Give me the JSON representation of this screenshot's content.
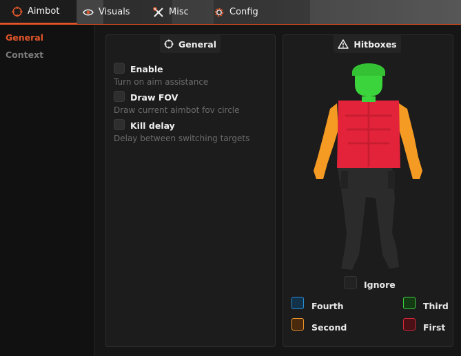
{
  "tabs": [
    {
      "label": "Aimbot",
      "icon": "crosshair-icon"
    },
    {
      "label": "Visuals",
      "icon": "eye-icon"
    },
    {
      "label": "Misc",
      "icon": "tools-icon"
    },
    {
      "label": "Config",
      "icon": "gear-icon"
    }
  ],
  "active_tab": "Aimbot",
  "sidebar": {
    "items": [
      {
        "label": "General",
        "active": true
      },
      {
        "label": "Context",
        "active": false
      }
    ]
  },
  "general_panel": {
    "title": "General",
    "title_icon": "crosshair-icon",
    "options": [
      {
        "label": "Enable",
        "description": "Turn on aim assistance",
        "checked": false
      },
      {
        "label": "Draw FOV",
        "description": "Draw current aimbot fov circle",
        "checked": false
      },
      {
        "label": "Kill delay",
        "description": "Delay between switching targets",
        "checked": false
      }
    ]
  },
  "hitbox_panel": {
    "title": "Hitboxes",
    "title_icon": "warning-triangle-icon",
    "ignore_label": "Ignore",
    "legend": [
      {
        "label": "Fourth",
        "color": "#2a8fd6"
      },
      {
        "label": "Third",
        "color": "#3fcf3f"
      },
      {
        "label": "Second",
        "color": "#f0952a"
      },
      {
        "label": "First",
        "color": "#d9283a"
      }
    ],
    "zones": {
      "head": "#3cd43c",
      "torso": "#e3233a",
      "arms": "#f59a22",
      "legs": "#2b2b2b"
    }
  },
  "colors": {
    "accent": "#e2562a",
    "sidebar_active": "#e2562a",
    "sidebar_inactive": "#7a7a7a"
  }
}
